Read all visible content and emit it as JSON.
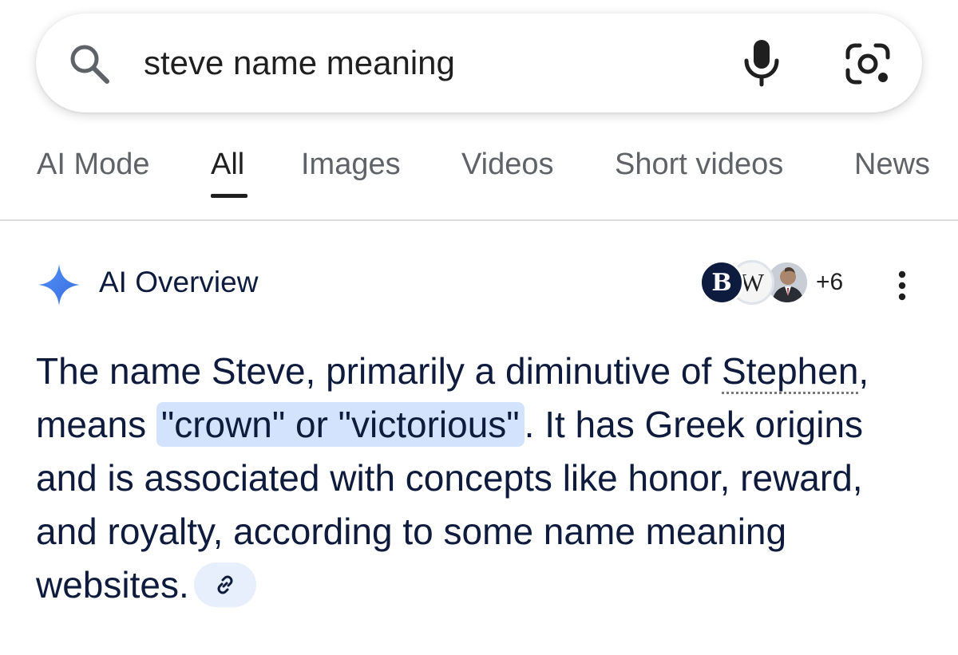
{
  "search": {
    "query": "steve name meaning",
    "icons": [
      "search-icon",
      "mic-icon",
      "google-lens-icon"
    ]
  },
  "tabs": [
    {
      "label": "AI Mode",
      "active": false
    },
    {
      "label": "All",
      "active": true
    },
    {
      "label": "Images",
      "active": false
    },
    {
      "label": "Videos",
      "active": false
    },
    {
      "label": "Short videos",
      "active": false
    },
    {
      "label": "News",
      "active": false
    }
  ],
  "ai_overview": {
    "title": "AI Overview",
    "sources": {
      "avatars": [
        "B",
        "W",
        "person-photo"
      ],
      "more_count": "+6"
    },
    "body": {
      "part1": "The name Steve, primarily a diminutive of ",
      "linked_term": "Stephen",
      "part2": ", means ",
      "highlight": "\"crown\" or \"victorious\"",
      "part3": ". It has Greek origins and is associated with concepts like honor, reward, and royalty, according to some name meaning websites."
    }
  },
  "colors": {
    "text": "#0e1b3d",
    "highlight": "#d3e3fd",
    "spark_blue": "#4285f4",
    "tab_inactive": "#5f6368"
  }
}
